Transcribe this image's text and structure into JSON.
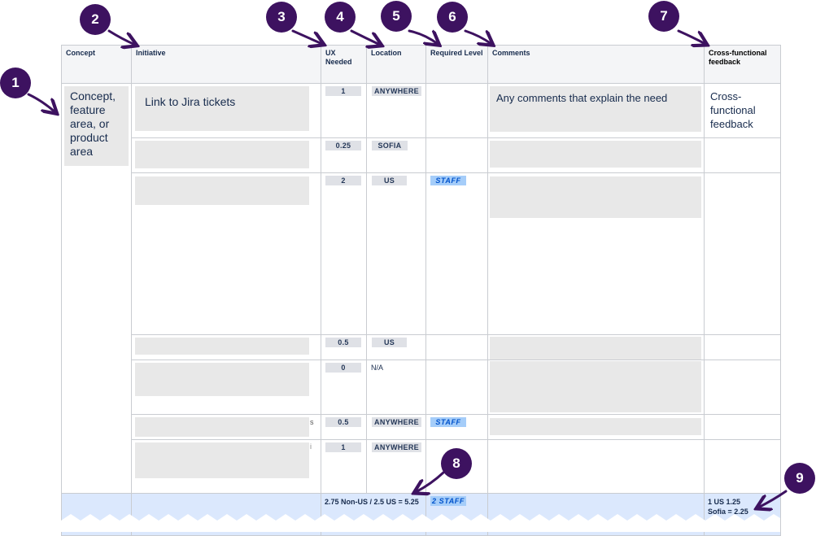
{
  "headers": [
    "Concept",
    "Initiative",
    "UX Needed",
    "Location",
    "Required Level",
    "Comments",
    "Cross-functional feedback"
  ],
  "concept_text": "Concept, feature area, or product area",
  "initiative_text": "Link to Jira tickets",
  "comments_text": "Any comments that explain the need",
  "crossfunctional_text": "Cross-functional feedback",
  "rows": [
    {
      "ux": "1",
      "location": "ANYWHERE",
      "level": ""
    },
    {
      "ux": "0.25",
      "location": "SOFIA",
      "level": ""
    },
    {
      "ux": "2",
      "location": "US",
      "level": "STAFF"
    },
    {
      "ux": "0.5",
      "location": "US",
      "level": ""
    },
    {
      "ux": "0",
      "location": "N/A",
      "level": ""
    },
    {
      "ux": "0.5",
      "location": "ANYWHERE",
      "level": "STAFF"
    },
    {
      "ux": "1",
      "location": "ANYWHERE",
      "level": ""
    }
  ],
  "stray_chars": [
    "s",
    "i"
  ],
  "totals": {
    "ux": "2.75 Non-US / 2.5 US = 5.25",
    "level": "2 STAFF",
    "feedback": "1 US 1.25 Sofia = 2.25"
  },
  "callouts": [
    "1",
    "2",
    "3",
    "4",
    "5",
    "6",
    "7",
    "8",
    "9"
  ],
  "colors": {
    "badge": "#3d1260",
    "header_bg": "#f4f5f7",
    "total_row_bg": "#dbe8fd",
    "staff_tag_bg": "#a5cdf9",
    "staff_tag_text": "#0052cc",
    "grey_placeholder": "#e8e8e8"
  }
}
